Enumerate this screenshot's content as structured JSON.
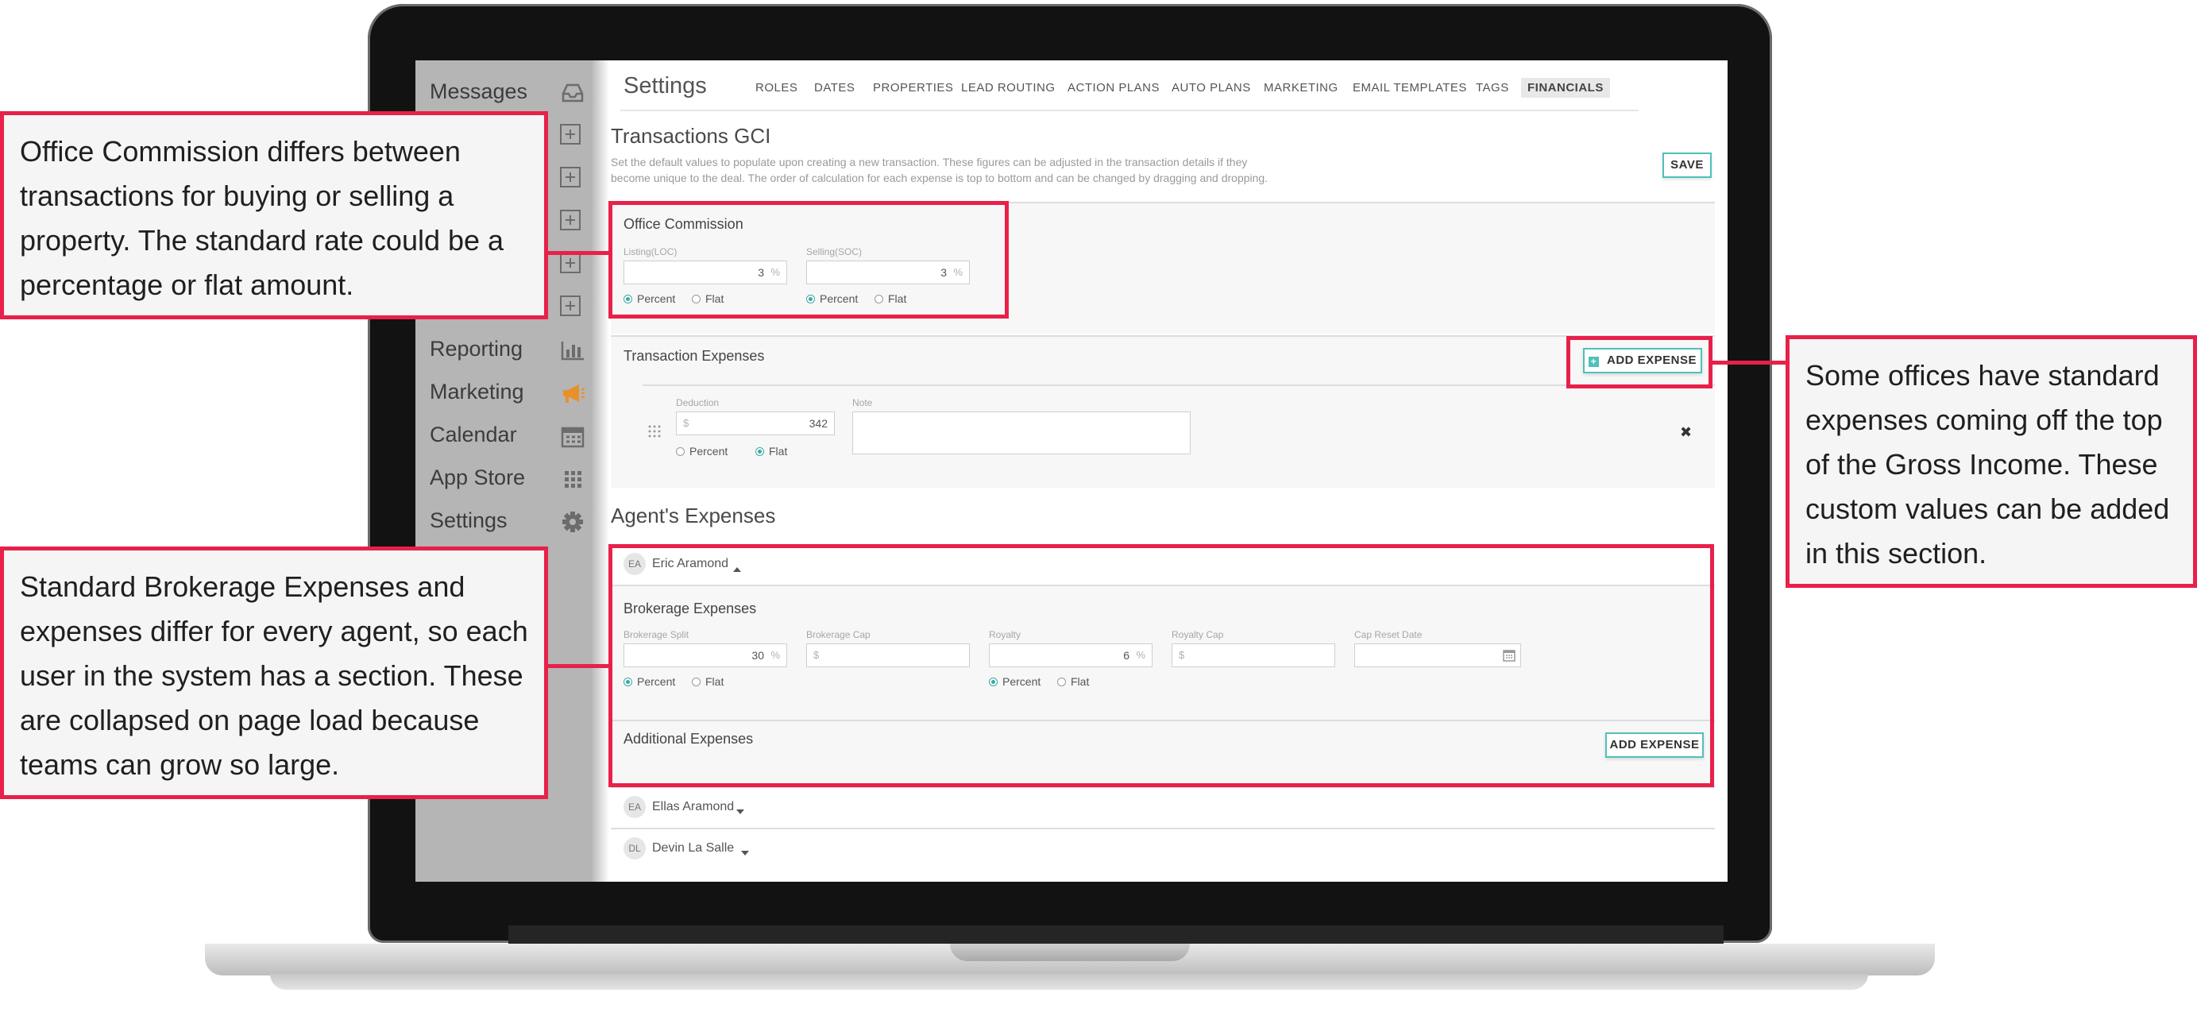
{
  "sidebar": {
    "items": [
      {
        "label": "Messages",
        "icon": "inbox-icon"
      },
      {
        "label": "",
        "icon": "plus-box-icon"
      },
      {
        "label": "",
        "icon": "plus-box-icon"
      },
      {
        "label": "",
        "icon": "plus-box-icon"
      },
      {
        "label": "",
        "icon": "plus-box-icon"
      },
      {
        "label": "",
        "icon": "plus-box-icon"
      },
      {
        "label": "Reporting",
        "icon": "bar-chart-icon"
      },
      {
        "label": "Marketing",
        "icon": "megaphone-icon"
      },
      {
        "label": "Calendar",
        "icon": "calendar-icon"
      },
      {
        "label": "App Store",
        "icon": "grid-icon"
      },
      {
        "label": "Settings",
        "icon": "gear-icon"
      }
    ]
  },
  "header": {
    "title": "Settings",
    "tabs": [
      "ROLES",
      "DATES",
      "PROPERTIES",
      "LEAD ROUTING",
      "ACTION PLANS",
      "AUTO PLANS",
      "MARKETING",
      "EMAIL TEMPLATES",
      "TAGS",
      "FINANCIALS"
    ],
    "active_tab": "FINANCIALS"
  },
  "gci": {
    "title": "Transactions GCI",
    "description_1": "Set the default values to populate upon creating a new transaction. These figures can be adjusted in the transaction details if they",
    "description_2": "become unique to the deal. The order of calculation for each expense is top to bottom and can be changed by dragging and dropping.",
    "save_label": "SAVE"
  },
  "office_commission": {
    "title": "Office Commission",
    "listing_label": "Listing(LOC)",
    "listing_value": "3",
    "selling_label": "Selling(SOC)",
    "selling_value": "3",
    "unit_percent": "%",
    "percent_label": "Percent",
    "flat_label": "Flat"
  },
  "transaction_expenses": {
    "title": "Transaction Expenses",
    "add_label": "ADD EXPENSE",
    "deduction_label": "Deduction",
    "deduction_currency": "$",
    "deduction_value": "342",
    "note_label": "Note",
    "percent_label": "Percent",
    "flat_label": "Flat",
    "remove_glyph": "✖"
  },
  "agents": {
    "title": "Agent's Expenses",
    "list": [
      {
        "initials": "EA",
        "name": "Eric Aramond",
        "expanded": true
      },
      {
        "initials": "EA",
        "name": "Ellas Aramond",
        "expanded": false
      },
      {
        "initials": "DL",
        "name": "Devin La Salle",
        "expanded": false
      }
    ],
    "brokerage": {
      "title": "Brokerage Expenses",
      "split_label": "Brokerage Split",
      "split_value": "30",
      "cap_label": "Brokerage Cap",
      "royalty_label": "Royalty",
      "royalty_value": "6",
      "royalty_cap_label": "Royalty Cap",
      "reset_label": "Cap Reset Date",
      "currency": "$",
      "unit_percent": "%",
      "percent_label": "Percent",
      "flat_label": "Flat"
    },
    "additional": {
      "title": "Additional Expenses",
      "add_label": "ADD EXPENSE"
    }
  },
  "callouts": {
    "office": "Office Commission differs between transactions for buying or selling a property. The standard rate could be a percentage or flat amount.",
    "brokerage": "Standard Brokerage Expenses and expenses differ for every agent, so each user in the system has a section. These are collapsed on page load because teams can grow so large.",
    "expenses": "Some offices have standard expenses coming off the top of the Gross Income. These custom values can be added in this section."
  },
  "colors": {
    "accent": "#4ec1ba",
    "callout": "#e8204a",
    "icon_orange": "#e8912a"
  }
}
